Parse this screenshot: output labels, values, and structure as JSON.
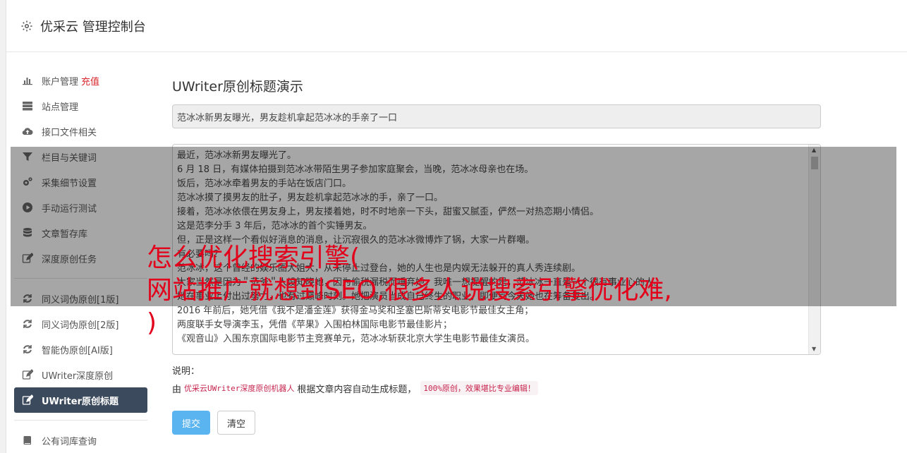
{
  "header": {
    "title": "优采云 管理控制台",
    "icon": "gear-icon"
  },
  "sidebar": {
    "items": [
      {
        "label": "账户管理",
        "badge": "充值",
        "icon": "bar-chart-icon"
      },
      {
        "label": "站点管理",
        "icon": "server-icon"
      },
      {
        "label": "接口文件相关",
        "icon": "cloud-upload-icon"
      },
      {
        "label": "栏目与关键词",
        "icon": "filter-icon"
      },
      {
        "label": "采集细节设置",
        "icon": "cogs-icon"
      },
      {
        "label": "手动运行测试",
        "icon": "play-circle-icon"
      },
      {
        "label": "文章暂存库",
        "icon": "database-icon"
      },
      {
        "label": "深度原创任务",
        "icon": "edit-icon"
      }
    ],
    "group2": [
      {
        "label": "同义词伪原创[1版]",
        "icon": "refresh-icon"
      },
      {
        "label": "同义词伪原创[2版]",
        "icon": "refresh-icon"
      },
      {
        "label": "智能伪原创[AI版]",
        "icon": "refresh-icon"
      },
      {
        "label": "UWriter深度原创",
        "icon": "edit-icon"
      },
      {
        "label": "UWriter原创标题",
        "icon": "edit-icon",
        "active": true
      }
    ],
    "group3": [
      {
        "label": "公有词库查询",
        "icon": "book-icon"
      }
    ]
  },
  "main": {
    "heading": "UWriter原创标题演示",
    "title_value": "范冰冰新男友曝光，男友趁机拿起范冰冰的手亲了一口",
    "content_lines": [
      "最近，范冰冰新男友曝光了。",
      "6 月 18 日，有媒体拍摄到范冰冰带陌生男子参加家庭聚会，当晚，范冰冰母亲也在场。",
      "饭后，范冰冰牵着男友的手站在饭店门口。",
      "范冰冰摸了摸男友的肚子，男友趁机拿起范冰冰的手，亲了一口。",
      "接着，范冰冰依偎在男友身上，男友搂着她，时不时地亲一下头，甜蜜又腻歪，俨然一对热恋期小情侣。",
      "这是范李分手 3 年后，范冰冰的首个实锤男友。",
      "但，正是这样一个看似好消息的消息，让沉寂很久的范冰冰微博炸了锅，大家一片群嘲。",
      "有必要吗？",
      "范冰冰，这个曾经的娱乐圈大姐大，从未停止过登台，她的人生也是内娱无法躲开的真人秀连续剧。",
      "大家当然是因为＂范爷＂人设知晓她，因为偷税漏税而唾弃她，我唯一想提醒的是，范冰冰一直是一个很有事业心的人。",
      "她在事业上付出过努力，也有过巅峰时刻。她把演员当成自己终生的职业，即便到今天她也在筹备复出。",
      "2016 年前后，她凭借《我不是潘金莲》获得金马奖和圣塞巴斯蒂安电影节最佳女主角；",
      "两度联手女导演李玉，凭借《苹果》入围柏林国际电影节最佳影片；",
      "《观音山》入围东京国际电影节主竞赛单元，范冰冰斩获北京大学生电影节最佳女演员。"
    ],
    "note_label": "说明：",
    "note_prefix": "由",
    "note_link": "优采云UWriter深度原创机器人",
    "note_middle": "根据文章内容自动生成标题，",
    "note_code": "100%原创，效果堪比专业编辑！",
    "submit_label": "提交",
    "clear_label": "清空"
  },
  "overlay": {
    "line1": "怎么优化搜索引擎(",
    "line2": "网站推广就想到SEO,很多人说搜索引擎优化难,",
    "line3": ")"
  }
}
